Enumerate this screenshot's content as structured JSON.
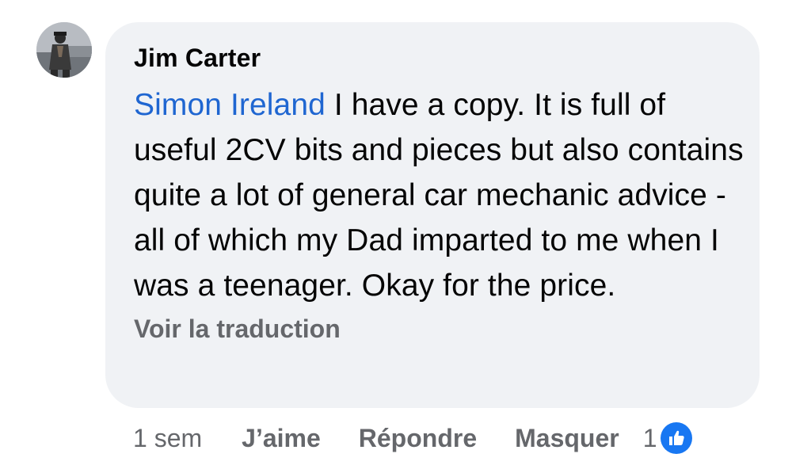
{
  "comment": {
    "author": "Jim Carter",
    "mention": "Simon Ireland",
    "text": " I have a copy. It is full of useful 2CV bits and pieces but also contains quite a lot of general car mechanic advice - all of which my Dad imparted to me when I was a teenager. Okay for the price.",
    "translate_label": "Voir la traduction"
  },
  "actions": {
    "time": "1 sem",
    "like_label": "J’aime",
    "reply_label": "Répondre",
    "hide_label": "Masquer",
    "reaction_count": "1"
  },
  "icons": {
    "avatar": "profile-photo",
    "reaction": "thumbs-up-icon"
  },
  "colors": {
    "mention": "#1f66d1",
    "bubble": "#f0f2f5",
    "secondary_text": "#65676b",
    "like_blue": "#1877f2"
  }
}
